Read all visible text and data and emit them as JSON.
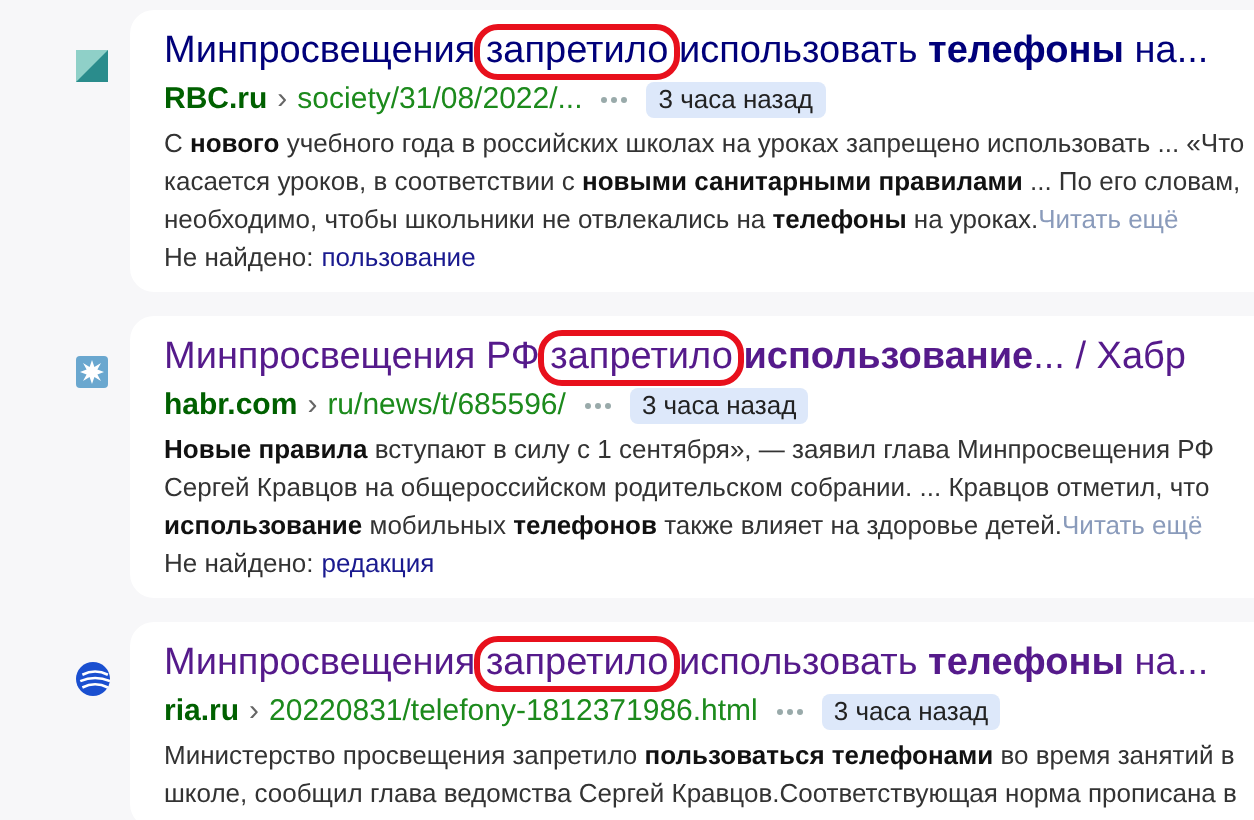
{
  "results": [
    {
      "favicon": {
        "kind": "diagonal"
      },
      "visited": false,
      "title_before": "Минпросвещения ",
      "title_circled": "запретило",
      "title_after": " использовать **телефоны** на...",
      "site": "RBC.ru",
      "separator": "›",
      "path": "society/31/08/2022/...",
      "time": "3 часа назад",
      "snippet": [
        "С **нового** учебного года в российских школах на уроках запрещено использовать ... «Что",
        "касается уроков, в соответствии с **новыми санитарными правилами** ... По его словам,",
        "необходимо, чтобы школьники не отвлекались на **телефоны** на уроках."
      ],
      "read_more": "Читать ещё",
      "not_found_label": "Не найдено:",
      "not_found_word": "пользование"
    },
    {
      "favicon": {
        "kind": "star"
      },
      "visited": true,
      "title_before": "Минпросвещения РФ ",
      "title_circled": "запретило",
      "title_after": " **использование**... / Хабр",
      "site": "habr.com",
      "separator": "›",
      "path": "ru/news/t/685596/",
      "time": "3 часа назад",
      "snippet": [
        "**Новые правила** вступают в силу с 1 сентября», — заявил глава Минпросвещения РФ",
        "Сергей Кравцов на общероссийском родительском собрании. ... Кравцов отметил, что",
        "**использование** мобильных **телефонов** также влияет на здоровье детей."
      ],
      "read_more": "Читать ещё",
      "not_found_label": "Не найдено:",
      "not_found_word": "редакция"
    },
    {
      "favicon": {
        "kind": "globe"
      },
      "visited": true,
      "title_before": "Минпросвещения ",
      "title_circled": "запретило",
      "title_after": " использовать **телефоны** на...",
      "site": "ria.ru",
      "separator": "›",
      "path": "20220831/telefony-1812371986.html",
      "time": "3 часа назад",
      "snippet": [
        "Министерство просвещения запретило **пользоваться телефонами** во время занятий в",
        "школе, сообщил глава ведомства Сергей Кравцов.Соответствующая норма прописана в"
      ]
    }
  ]
}
